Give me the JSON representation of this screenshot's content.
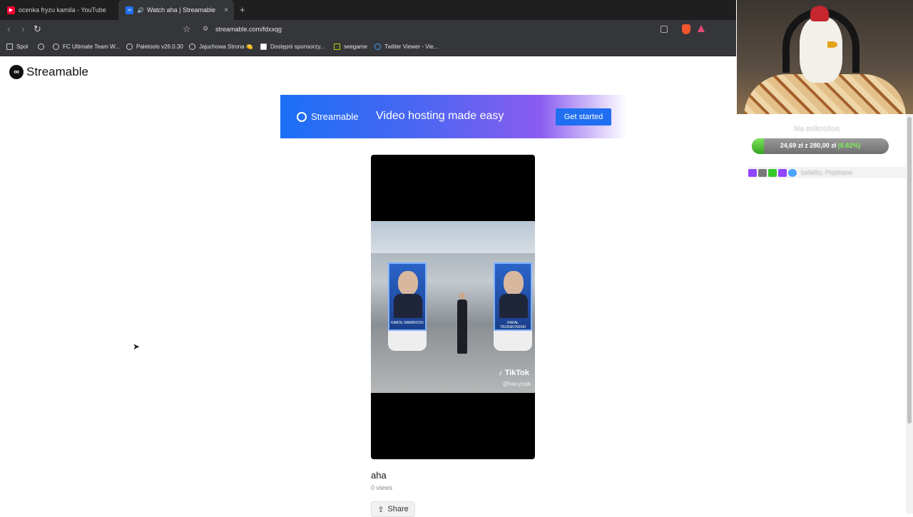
{
  "browser": {
    "tabs": [
      {
        "title": "ocenka fryzu kamila - YouTube",
        "active": false,
        "favicon_color": "#ff0033"
      },
      {
        "title": "Watch aha | Streamable",
        "active": true,
        "favicon_color": "#1f6ff0",
        "audio_icon": "🔊"
      }
    ],
    "new_tab": "+",
    "close": "×",
    "nav": {
      "back": "‹",
      "forward": "›",
      "reload": "↻",
      "bookmark": "☆"
    },
    "url": "streamable.com/fdxxqg",
    "bookmarks": [
      {
        "label": "Społ",
        "icon": "folder-icon"
      },
      {
        "label": "",
        "icon": "globe-icon"
      },
      {
        "label": "FC Ultimate Team W...",
        "icon": "globe-icon"
      },
      {
        "label": "Paletools v26.0.30",
        "icon": "globe-icon"
      },
      {
        "label": "Jajuchowa Strona 🍋",
        "icon": "globe-icon"
      },
      {
        "label": "Dostępni sponsorzy...",
        "icon": "square-icon"
      },
      {
        "label": "seegame",
        "icon": "square-icon"
      },
      {
        "label": "Twitter Viewer - Vie...",
        "icon": "globe-icon"
      }
    ]
  },
  "page": {
    "brand": "Streamable",
    "banner": {
      "brand": "Streamable",
      "tagline": "Video hosting made easy",
      "cta": "Get started"
    },
    "video": {
      "poster_left": "KAROL NAWROCKI",
      "poster_right": "RAFAŁ TRZASKOWSKI",
      "watermark": "TikTok",
      "handle": "@hanyssik"
    },
    "title": "aha",
    "views": "0 views",
    "share": "Share"
  },
  "overlay": {
    "goal_label": "Na mikrofon",
    "goal_text": "24,69 zł z 280,00 zł",
    "goal_pct_text": "(8.82%)",
    "goal_fraction": 0.0882,
    "chat_user": "kafelix:",
    "chat_message": "Pojebane"
  }
}
